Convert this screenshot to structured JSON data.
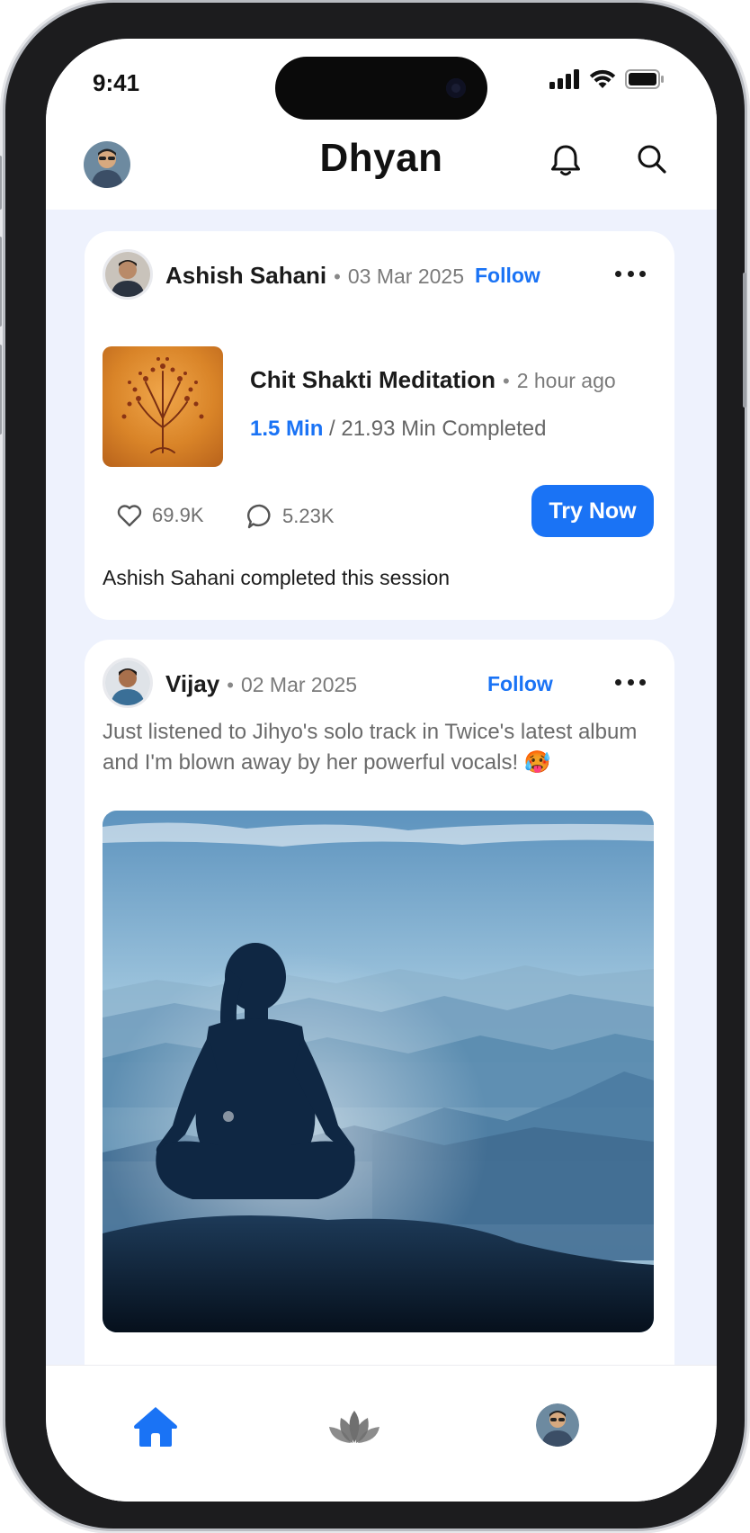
{
  "status_bar": {
    "time": "9:41"
  },
  "header": {
    "title": "Dhyan"
  },
  "posts": [
    {
      "author": "Ashish Sahani",
      "date": "03 Mar 2025",
      "follow_label": "Follow",
      "session": {
        "title": "Chit Shakti Meditation",
        "ago": "2 hour ago",
        "progress_done": "1.5 Min",
        "progress_rest": " / 21.93 Min Completed"
      },
      "likes": "69.9K",
      "comments": "5.23K",
      "cta_label": "Try Now",
      "note": "Ashish Sahani completed this session"
    },
    {
      "author": "Vijay",
      "date": "02 Mar 2025",
      "follow_label": "Follow",
      "text": "Just listened to Jihyo's solo track in Twice's latest album and I'm blown away by her powerful vocals! 🥵"
    }
  ],
  "nav": {
    "items": [
      {
        "icon": "home-icon",
        "active": true
      },
      {
        "icon": "lotus-icon",
        "active": false
      },
      {
        "icon": "profile-avatar",
        "active": false
      }
    ]
  },
  "colors": {
    "accent": "#1a73f5",
    "feed_background": "#eef2fd",
    "card": "#ffffff"
  }
}
